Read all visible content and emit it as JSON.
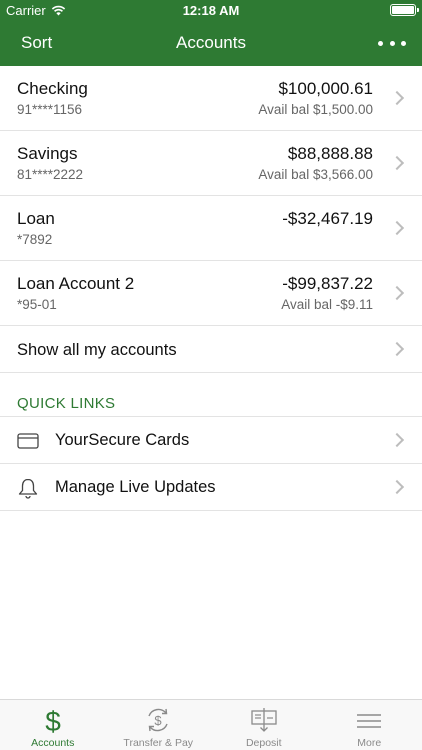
{
  "status_bar": {
    "carrier": "Carrier",
    "time": "12:18 AM"
  },
  "nav": {
    "left_label": "Sort",
    "title": "Accounts",
    "more_icon": "ellipsis-icon"
  },
  "accounts": [
    {
      "name": "Checking",
      "number": "91****1156",
      "amount": "$100,000.61",
      "available": "Avail bal $1,500.00"
    },
    {
      "name": "Savings",
      "number": "81****2222",
      "amount": "$88,888.88",
      "available": "Avail bal $3,566.00"
    },
    {
      "name": "Loan",
      "number": "*7892",
      "amount": "-$32,467.19",
      "available": ""
    },
    {
      "name": "Loan Account 2",
      "number": "*95-01",
      "amount": "-$99,837.22",
      "available": "Avail bal -$9.11"
    }
  ],
  "show_all": {
    "label": "Show all my accounts"
  },
  "quick_links": {
    "heading": "QUICK LINKS",
    "items": [
      {
        "label": "YourSecure Cards",
        "icon": "credit-card-icon"
      },
      {
        "label": "Manage Live Updates",
        "icon": "bell-icon"
      }
    ]
  },
  "tab_bar": {
    "tabs": [
      {
        "label": "Accounts",
        "icon": "dollar-icon",
        "active": true
      },
      {
        "label": "Transfer & Pay",
        "icon": "transfer-dollar-icon",
        "active": false
      },
      {
        "label": "Deposit",
        "icon": "check-deposit-icon",
        "active": false
      },
      {
        "label": "More",
        "icon": "menu-icon",
        "active": false
      }
    ]
  },
  "colors": {
    "brand_green": "#2e7a33",
    "inactive_gray": "#8a8a8a"
  }
}
